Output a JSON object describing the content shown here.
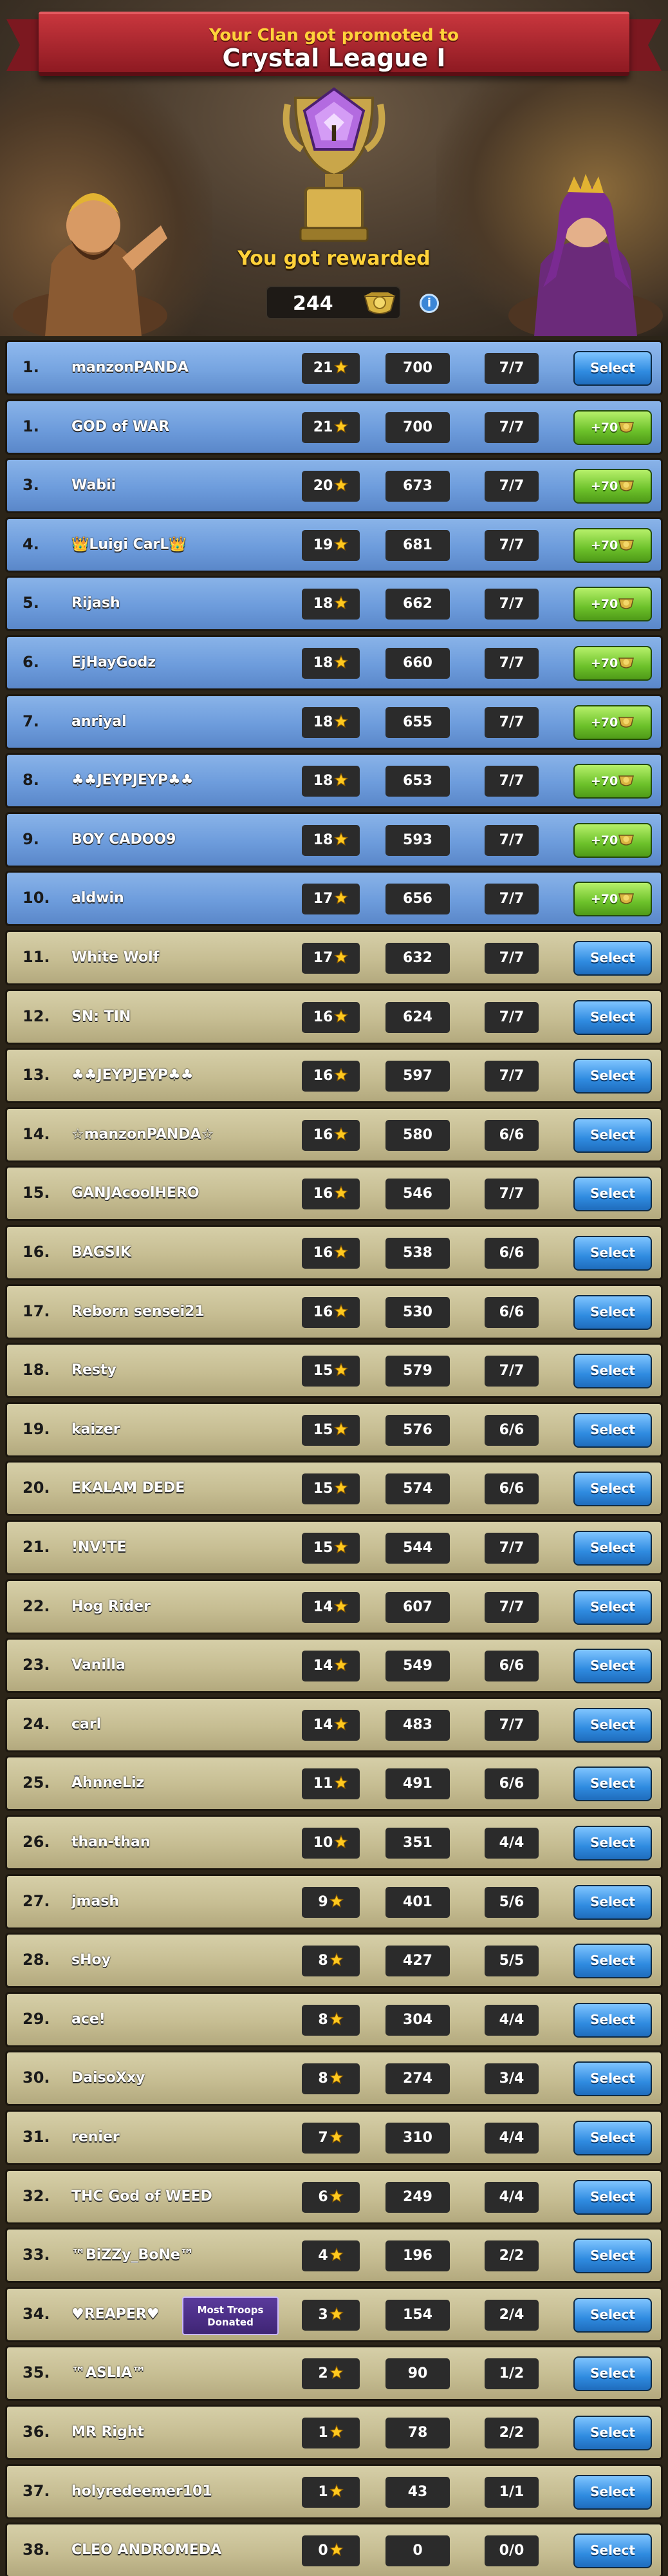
{
  "header": {
    "subtitle": "Your Clan got promoted to",
    "title": "Crystal League I",
    "league_number": "I",
    "reward_text": "You got rewarded",
    "reward_amount": "244",
    "info_label": "i"
  },
  "colors": {
    "banner_red": "#b8262e",
    "tan_row": "#c6bd92",
    "blue_row": "#6d9cdc",
    "select_button": "#2f8be0",
    "bonus_button": "#6cc12a",
    "badge_purple": "#4a2c86"
  },
  "icons": {
    "star": "star-icon",
    "medal": "war-league-medal-icon",
    "trophy": "crystal-league-trophy-icon",
    "info": "info-icon"
  },
  "select_label": "Select",
  "rows": [
    {
      "rank": "1.",
      "name": "manzonPANDA",
      "stars": "21",
      "points": "700",
      "attacks": "7/7",
      "button": "Select",
      "style": "self"
    },
    {
      "rank": "1.",
      "name": "GOD of WAR",
      "stars": "21",
      "points": "700",
      "attacks": "7/7",
      "button": "+70",
      "style": "blue"
    },
    {
      "rank": "3.",
      "name": "Wabii",
      "stars": "20",
      "points": "673",
      "attacks": "7/7",
      "button": "+70",
      "style": "blue"
    },
    {
      "rank": "4.",
      "name": "👑Luigi CarL👑",
      "stars": "19",
      "points": "681",
      "attacks": "7/7",
      "button": "+70",
      "style": "blue"
    },
    {
      "rank": "5.",
      "name": "Rijash",
      "stars": "18",
      "points": "662",
      "attacks": "7/7",
      "button": "+70",
      "style": "blue"
    },
    {
      "rank": "6.",
      "name": "EjHayGodz",
      "stars": "18",
      "points": "660",
      "attacks": "7/7",
      "button": "+70",
      "style": "blue"
    },
    {
      "rank": "7.",
      "name": "anriyal",
      "stars": "18",
      "points": "655",
      "attacks": "7/7",
      "button": "+70",
      "style": "blue"
    },
    {
      "rank": "8.",
      "name": "♣♣JEYPJEYP♣♣",
      "stars": "18",
      "points": "653",
      "attacks": "7/7",
      "button": "+70",
      "style": "blue"
    },
    {
      "rank": "9.",
      "name": "BOY CADOO9",
      "stars": "18",
      "points": "593",
      "attacks": "7/7",
      "button": "+70",
      "style": "blue"
    },
    {
      "rank": "10.",
      "name": "aldwin",
      "stars": "17",
      "points": "656",
      "attacks": "7/7",
      "button": "+70",
      "style": "blue"
    },
    {
      "rank": "11.",
      "name": "White Wolf",
      "stars": "17",
      "points": "632",
      "attacks": "7/7",
      "button": "Select",
      "style": "tan"
    },
    {
      "rank": "12.",
      "name": "SN: TIN",
      "stars": "16",
      "points": "624",
      "attacks": "7/7",
      "button": "Select",
      "style": "tan"
    },
    {
      "rank": "13.",
      "name": "♣♣JEYPJEYP♣♣",
      "stars": "16",
      "points": "597",
      "attacks": "7/7",
      "button": "Select",
      "style": "tan"
    },
    {
      "rank": "14.",
      "name": "☆manzonPANDA☆",
      "stars": "16",
      "points": "580",
      "attacks": "6/6",
      "button": "Select",
      "style": "tan"
    },
    {
      "rank": "15.",
      "name": "GANJAcoolHERO",
      "stars": "16",
      "points": "546",
      "attacks": "7/7",
      "button": "Select",
      "style": "tan"
    },
    {
      "rank": "16.",
      "name": "BAGSIK",
      "stars": "16",
      "points": "538",
      "attacks": "6/6",
      "button": "Select",
      "style": "tan"
    },
    {
      "rank": "17.",
      "name": "Reborn sensei21",
      "stars": "16",
      "points": "530",
      "attacks": "6/6",
      "button": "Select",
      "style": "tan"
    },
    {
      "rank": "18.",
      "name": "Resty",
      "stars": "15",
      "points": "579",
      "attacks": "7/7",
      "button": "Select",
      "style": "tan"
    },
    {
      "rank": "19.",
      "name": "kaizer",
      "stars": "15",
      "points": "576",
      "attacks": "6/6",
      "button": "Select",
      "style": "tan"
    },
    {
      "rank": "20.",
      "name": "EKALAM DEDE",
      "stars": "15",
      "points": "574",
      "attacks": "6/6",
      "button": "Select",
      "style": "tan"
    },
    {
      "rank": "21.",
      "name": "!NV!TE",
      "stars": "15",
      "points": "544",
      "attacks": "7/7",
      "button": "Select",
      "style": "tan"
    },
    {
      "rank": "22.",
      "name": "Hog Rider",
      "stars": "14",
      "points": "607",
      "attacks": "7/7",
      "button": "Select",
      "style": "tan"
    },
    {
      "rank": "23.",
      "name": "Vanilla",
      "stars": "14",
      "points": "549",
      "attacks": "6/6",
      "button": "Select",
      "style": "tan"
    },
    {
      "rank": "24.",
      "name": "carl",
      "stars": "14",
      "points": "483",
      "attacks": "7/7",
      "button": "Select",
      "style": "tan"
    },
    {
      "rank": "25.",
      "name": "ÄhnneLiz",
      "stars": "11",
      "points": "491",
      "attacks": "6/6",
      "button": "Select",
      "style": "tan"
    },
    {
      "rank": "26.",
      "name": "than-than",
      "stars": "10",
      "points": "351",
      "attacks": "4/4",
      "button": "Select",
      "style": "tan"
    },
    {
      "rank": "27.",
      "name": "jmash",
      "stars": "9",
      "points": "401",
      "attacks": "5/6",
      "button": "Select",
      "style": "tan"
    },
    {
      "rank": "28.",
      "name": "sHoy",
      "stars": "8",
      "points": "427",
      "attacks": "5/5",
      "button": "Select",
      "style": "tan"
    },
    {
      "rank": "29.",
      "name": "ace!",
      "stars": "8",
      "points": "304",
      "attacks": "4/4",
      "button": "Select",
      "style": "tan"
    },
    {
      "rank": "30.",
      "name": "DaisoXxy",
      "stars": "8",
      "points": "274",
      "attacks": "3/4",
      "button": "Select",
      "style": "tan"
    },
    {
      "rank": "31.",
      "name": "renier",
      "stars": "7",
      "points": "310",
      "attacks": "4/4",
      "button": "Select",
      "style": "tan"
    },
    {
      "rank": "32.",
      "name": "THC God of WEED",
      "stars": "6",
      "points": "249",
      "attacks": "4/4",
      "button": "Select",
      "style": "tan"
    },
    {
      "rank": "33.",
      "name": "™BiZZy_BoNe™",
      "stars": "4",
      "points": "196",
      "attacks": "2/2",
      "button": "Select",
      "style": "tan"
    },
    {
      "rank": "34.",
      "name": "♥REAPER♥",
      "stars": "3",
      "points": "154",
      "attacks": "2/4",
      "button": "Select",
      "style": "tan",
      "badge": "Most Troops Donated"
    },
    {
      "rank": "35.",
      "name": "™ASLIA™",
      "stars": "2",
      "points": "90",
      "attacks": "1/2",
      "button": "Select",
      "style": "tan"
    },
    {
      "rank": "36.",
      "name": "MR Right",
      "stars": "1",
      "points": "78",
      "attacks": "2/2",
      "button": "Select",
      "style": "tan"
    },
    {
      "rank": "37.",
      "name": "holyredeemer101",
      "stars": "1",
      "points": "43",
      "attacks": "1/1",
      "button": "Select",
      "style": "tan"
    },
    {
      "rank": "38.",
      "name": "CLEO ANDROMEDA",
      "stars": "0",
      "points": "0",
      "attacks": "0/0",
      "button": "Select",
      "style": "tan"
    }
  ]
}
